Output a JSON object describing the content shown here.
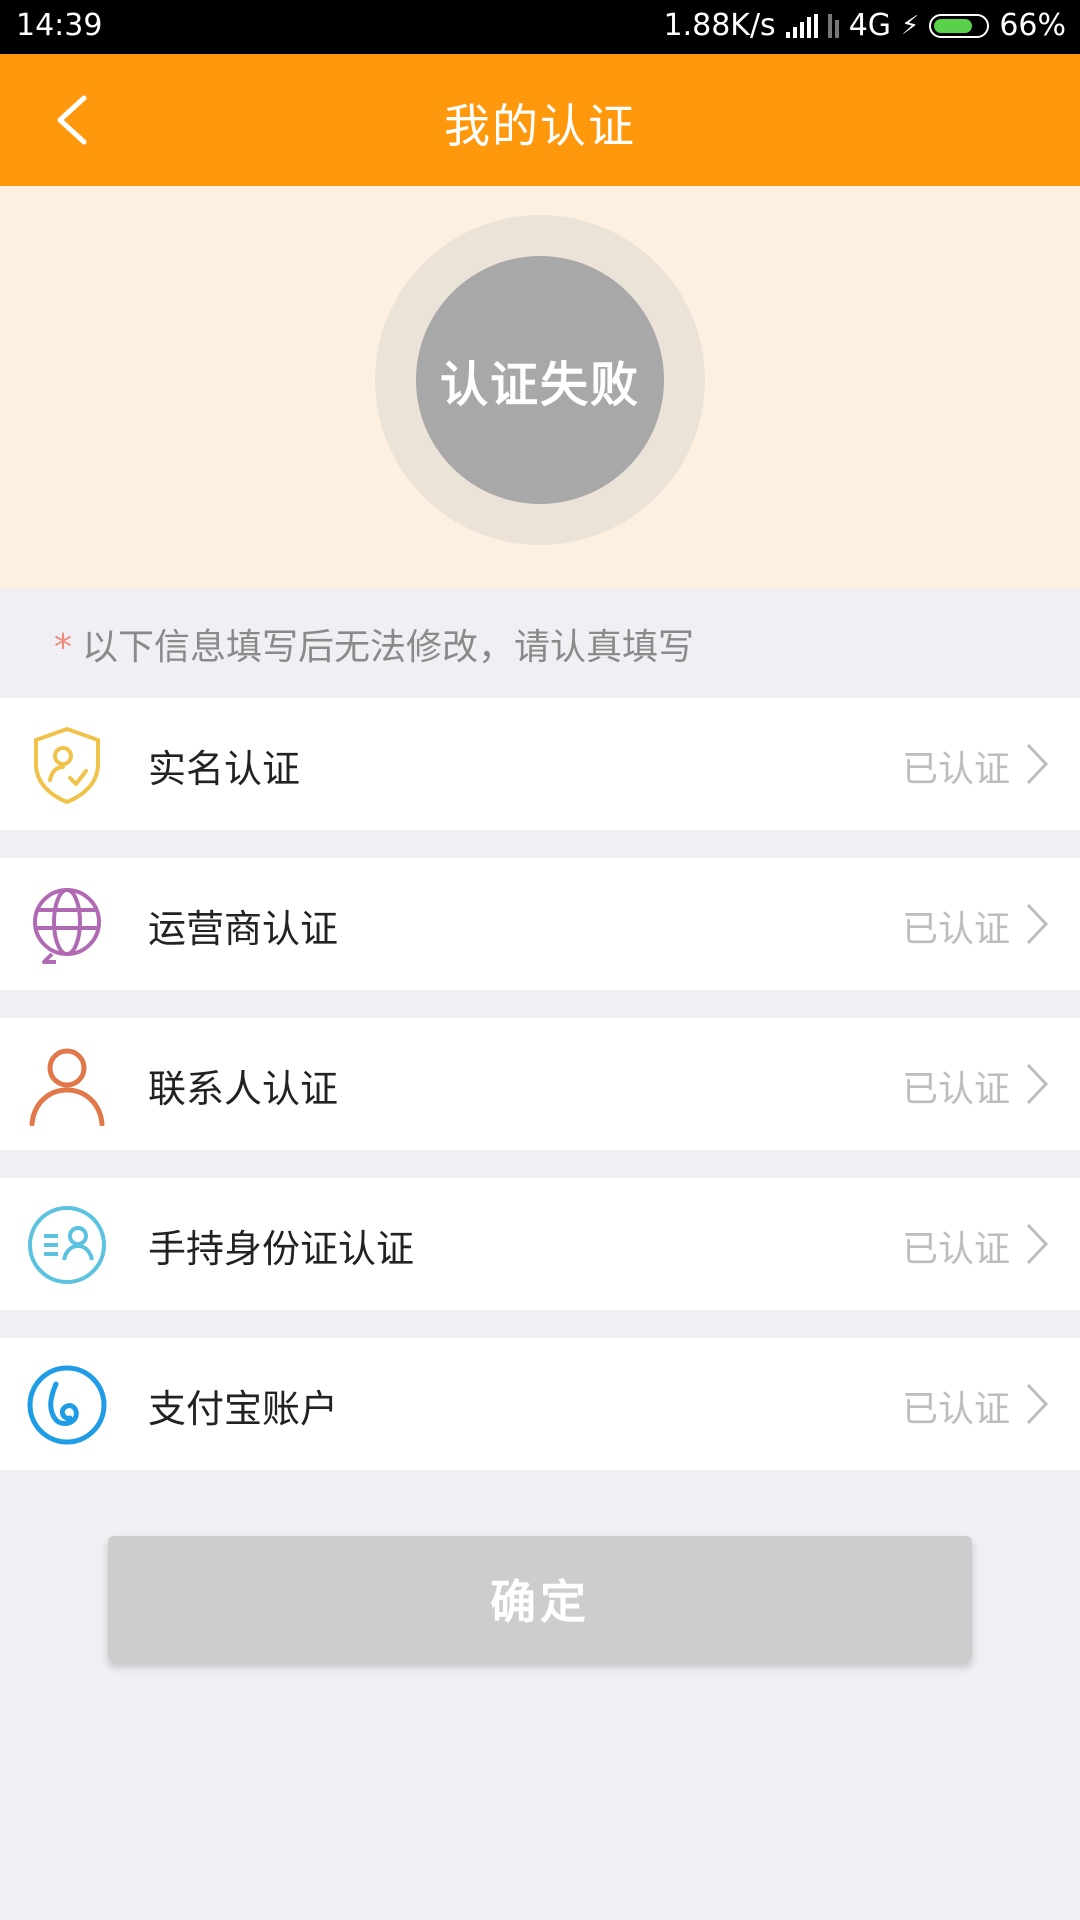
{
  "status_bar": {
    "time": "14:39",
    "network_speed": "1.88K/s",
    "network_type": "4G",
    "battery": "66%"
  },
  "header": {
    "title": "我的认证",
    "back_icon": "chevron-left-icon"
  },
  "hero": {
    "status_text": "认证失败"
  },
  "notice": {
    "star": "*",
    "text": "以下信息填写后无法修改，请认真填写"
  },
  "items": [
    {
      "label": "实名认证",
      "status": "已认证",
      "icon": "shield-user-icon",
      "color": "#f0c24a"
    },
    {
      "label": "运营商认证",
      "status": "已认证",
      "icon": "globe-icon",
      "color": "#b06ab3"
    },
    {
      "label": "联系人认证",
      "status": "已认证",
      "icon": "person-icon",
      "color": "#e0784a"
    },
    {
      "label": "手持身份证认证",
      "status": "已认证",
      "icon": "id-card-icon",
      "color": "#5bc2e0"
    },
    {
      "label": "支付宝账户",
      "status": "已认证",
      "icon": "alipay-icon",
      "color": "#1e9ce6"
    }
  ],
  "confirm_button": {
    "label": "确定"
  },
  "colors": {
    "accent": "#ff980c",
    "hero_bg": "#fdf0e0",
    "button_disabled": "#cdcdcd"
  }
}
